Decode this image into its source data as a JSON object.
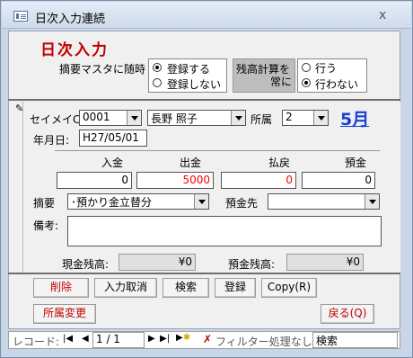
{
  "window": {
    "title": "日次入力連続",
    "close_glyph": "ⅹ"
  },
  "header": {
    "heading": "日次入力"
  },
  "summary_option": {
    "label": "摘要マスタに随時",
    "opt1": "登録する",
    "opt2": "登録しない",
    "selected": "登録する"
  },
  "balance_option": {
    "label_line1": "残高計算を",
    "label_line2": "常に",
    "opt1": "行う",
    "opt2": "行わない",
    "selected": "行わない"
  },
  "record": {
    "id_label": "セイメイCD",
    "id_value": "0001",
    "name_value": "長野 照子",
    "dept_label": "所属",
    "dept_value": "2",
    "month_link": "5月",
    "date_label": "年月日:",
    "date_value": "H27/05/01"
  },
  "amounts": {
    "deposit_label": "入金",
    "deposit_value": "0",
    "withdraw_label": "出金",
    "withdraw_value": "5000",
    "refund_label": "払戻",
    "refund_value": "0",
    "savings_label": "預金",
    "savings_value": "0"
  },
  "detail": {
    "summary_label": "摘要",
    "summary_value": "･預かり金立替分",
    "savings_dest_label": "預金先",
    "savings_dest_value": "",
    "note_label": "備考:",
    "note_value": ""
  },
  "balances": {
    "cash_label": "現金残高:",
    "cash_value": "¥0",
    "savings_label": "預金残高:",
    "savings_value": "¥0"
  },
  "buttons": {
    "delete": "削除",
    "cancel": "入力取消",
    "search": "検索",
    "register": "登録",
    "copy": "Copy(R)",
    "dept_change": "所属変更",
    "back": "戻る(Q)"
  },
  "navigation": {
    "record_label": "レコード:",
    "position": "1 / 1",
    "filter_label": "フィルター処理なし",
    "search_label": "検索"
  },
  "colors": {
    "heading_red": "#c00000",
    "link_blue": "#1c3fd6",
    "value_red": "#ff0000"
  }
}
